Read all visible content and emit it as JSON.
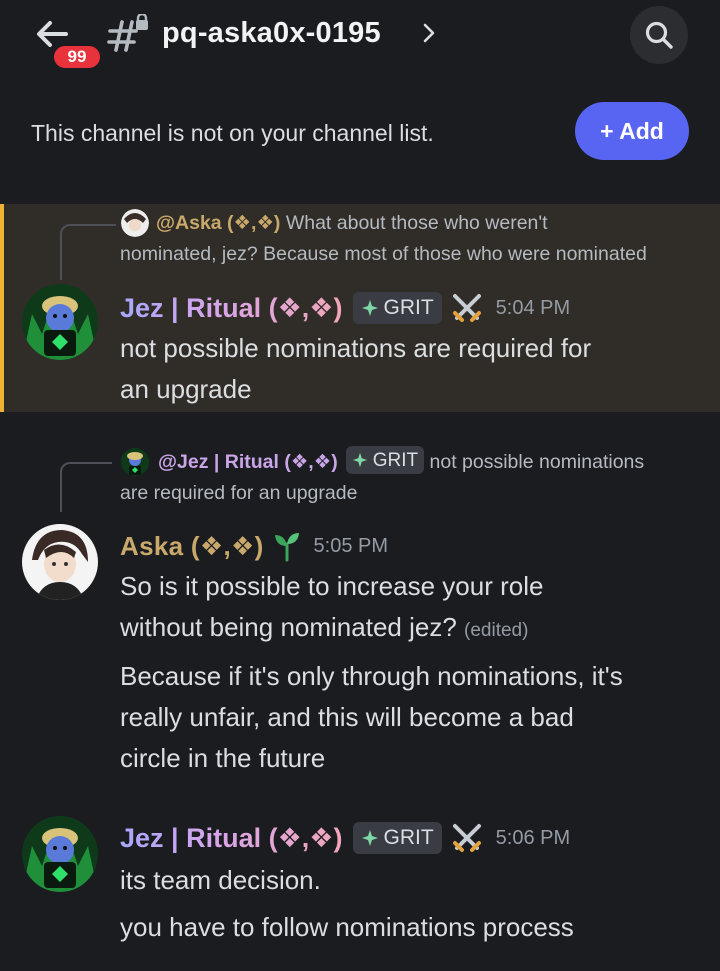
{
  "header": {
    "unread_count": "99",
    "channel_name": "pq-aska0x-0195",
    "chevron": "›"
  },
  "notice": {
    "text": "This channel is not on your channel list.",
    "add_label": "+ Add"
  },
  "messages": [
    {
      "reply": {
        "author": "@Aska (❖,❖)",
        "text_line1": " What about those who weren't",
        "text_line2": "nominated, jez? Because most of those who were nominated"
      },
      "author": "Jez | Ritual (❖,❖)",
      "tag": "GRIT",
      "timestamp": "5:04 PM",
      "lines": [
        "not  possible nominations are required for",
        "an upgrade"
      ]
    },
    {
      "reply": {
        "author": "@Jez | Ritual (❖,❖)",
        "tag": "GRIT",
        "text_line1": " not  possible nominations",
        "text_line2": "are required for an upgrade"
      },
      "author": "Aska (❖,❖)",
      "timestamp": "5:05 PM",
      "lines": [
        "So is it possible to increase your role",
        "without being nominated jez?"
      ],
      "edited": "(edited)",
      "lines2": [
        "Because if it's only through nominations, it's",
        "really unfair, and this will become a bad",
        "circle in the future"
      ]
    },
    {
      "author": "Jez | Ritual (❖,❖)",
      "tag": "GRIT",
      "timestamp": "5:06 PM",
      "lines": [
        "its team decision."
      ],
      "lines2": [
        "you have to follow nominations process"
      ]
    }
  ],
  "icons": {
    "back": "arrow-left-icon",
    "channel": "hash-lock-icon",
    "search": "search-icon",
    "tag": "diamond-sparkle-icon",
    "role": "crossed-swords-icon",
    "newbie": "seedling-icon"
  }
}
